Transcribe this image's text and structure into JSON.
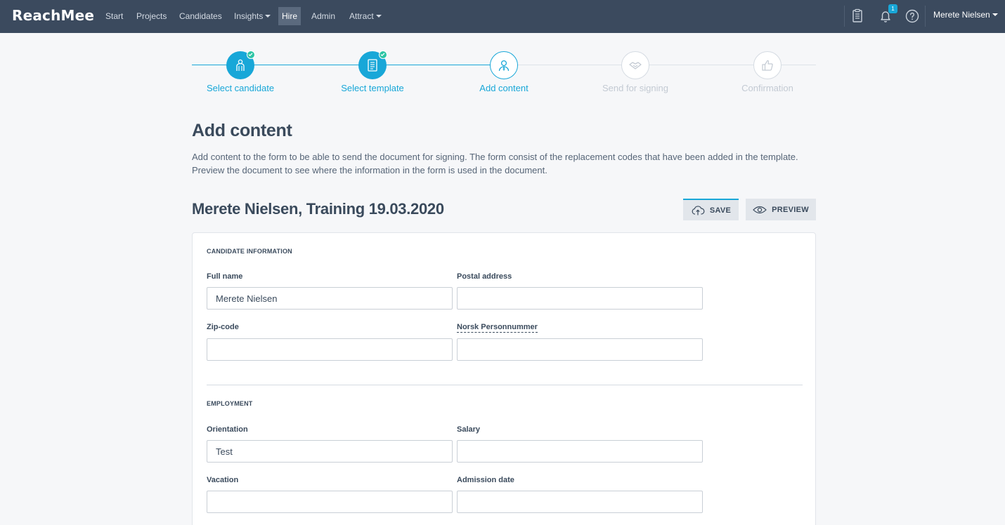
{
  "brand": {
    "name": "ReachMee",
    "accent": "#18a7d8",
    "nav_bg": "#3b4a5e"
  },
  "nav": {
    "items": [
      {
        "label": "Start"
      },
      {
        "label": "Projects"
      },
      {
        "label": "Candidates"
      },
      {
        "label": "Insights",
        "dropdown": true
      },
      {
        "label": "Hire",
        "active": true
      },
      {
        "label": "Admin"
      },
      {
        "label": "Attract",
        "dropdown": true
      }
    ],
    "icons": [
      "clipboard-icon",
      "bell-icon",
      "help-icon"
    ],
    "notification_count": "1",
    "user": "Merete Nielsen"
  },
  "stepper": {
    "steps": [
      {
        "label": "Select candidate",
        "state": "done",
        "icon": "candidate-icon"
      },
      {
        "label": "Select template",
        "state": "done",
        "icon": "document-icon"
      },
      {
        "label": "Add content",
        "state": "current",
        "icon": "person-icon"
      },
      {
        "label": "Send for signing",
        "state": "future",
        "icon": "handshake-icon"
      },
      {
        "label": "Confirmation",
        "state": "future",
        "icon": "thumbs-up-icon"
      }
    ]
  },
  "page": {
    "title": "Add content",
    "description": "Add content to the form to be able to send the document for signing. The form consist of the replacement codes that have been added in the template. Preview the document to see where the information in the form is used in the document.",
    "document_title": "Merete Nielsen, Training 19.03.2020"
  },
  "actions": {
    "save_label": "SAVE",
    "preview_label": "PREVIEW"
  },
  "form": {
    "sections": [
      {
        "title": "CANDIDATE INFORMATION",
        "fields": [
          {
            "label": "Full name",
            "value": "Merete Nielsen"
          },
          {
            "label": "Postal address",
            "value": ""
          },
          {
            "label": "Zip-code",
            "value": ""
          },
          {
            "label": "Norsk Personnummer",
            "value": "",
            "tooltip": true
          }
        ]
      },
      {
        "title": "EMPLOYMENT",
        "fields": [
          {
            "label": "Orientation",
            "value": "Test"
          },
          {
            "label": "Salary",
            "value": ""
          },
          {
            "label": "Vacation",
            "value": ""
          },
          {
            "label": "Admission date",
            "value": ""
          }
        ]
      }
    ]
  }
}
